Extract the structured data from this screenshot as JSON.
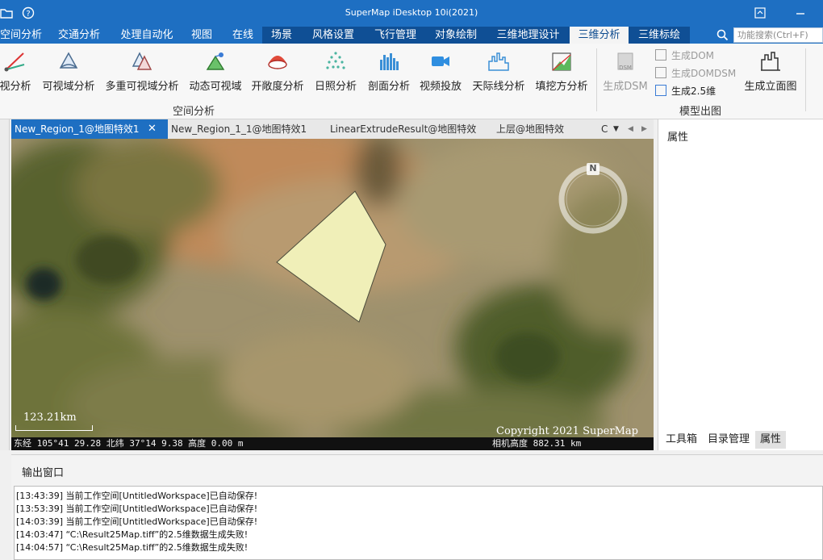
{
  "app": {
    "title": "SuperMap iDesktop 10i(2021)"
  },
  "menu_tabs": [
    "空间分析",
    "交通分析",
    "处理自动化",
    "视图",
    "在线",
    "场景",
    "风格设置",
    "飞行管理",
    "对象绘制",
    "三维地理设计",
    "三维分析",
    "三维标绘"
  ],
  "search": {
    "placeholder": "功能搜索(Ctrl+F)"
  },
  "ribbon": {
    "analysis_buttons": [
      "视分析",
      "可视域分析",
      "多重可视域分析",
      "动态可视域",
      "开敞度分析",
      "日照分析",
      "剖面分析",
      "视频投放",
      "天际线分析",
      "填挖方分析"
    ],
    "analysis_group": "空间分析",
    "model_buttons": {
      "dsm": "生成DSM",
      "dom": "生成DOM",
      "domdsm": "生成DOMDSM",
      "twohalf": "生成2.5维",
      "elevation": "生成立面图"
    },
    "model_group": "模型出图"
  },
  "doc_tabs": [
    "New_Region_1@地图特效1",
    "New_Region_1_1@地图特效1",
    "LinearExtrudeResult@地图特效",
    "上层@地图特效",
    "C"
  ],
  "map": {
    "compass": "N",
    "scale": "123.21km",
    "copyright": "Copyright 2021 SuperMap",
    "coords": "东经 105°41   29.28  北纬 37°14   9.38  高度 0.00 m",
    "camera": "相机高度 882.31 km"
  },
  "properties": {
    "title": "属性",
    "tabs": [
      "工具箱",
      "目录管理",
      "属性"
    ]
  },
  "output": {
    "title": "输出窗口",
    "lines": [
      "[13:43:39] 当前工作空间[UntitledWorkspace]已自动保存!",
      "[13:53:39] 当前工作空间[UntitledWorkspace]已自动保存!",
      "[14:03:39] 当前工作空间[UntitledWorkspace]已自动保存!",
      "[14:03:47] “C:\\Result25Map.tiff”的2.5维数据生成失败!",
      "[14:04:57] “C:\\Result25Map.tiff”的2.5维数据生成失败!"
    ]
  },
  "colors": {
    "titlebar": "#1e6fc2",
    "polygon": "#f0efb8"
  }
}
